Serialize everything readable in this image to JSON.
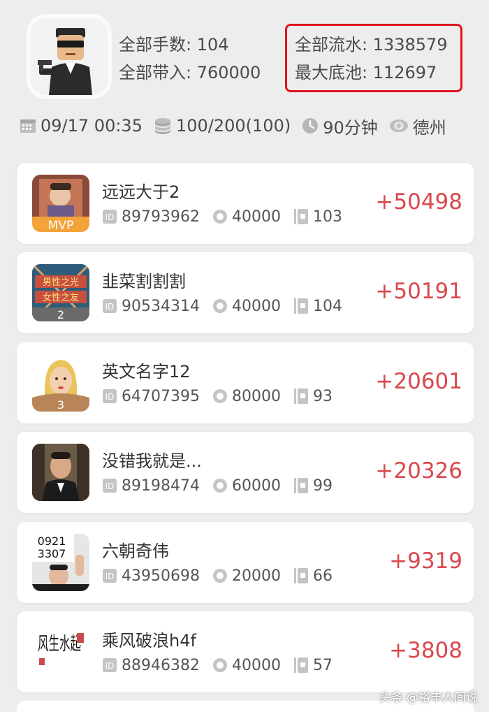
{
  "header": {
    "total_hands": "全部手数: 104",
    "total_buyin": "全部带入: 760000",
    "total_flow": "全部流水: 1338579",
    "max_pot": "最大底池: 112697"
  },
  "meta": {
    "datetime": "09/17 00:35",
    "blinds": "100/200(100)",
    "duration": "90分钟",
    "game": "德州"
  },
  "icons": {
    "calendar": "calendar-icon",
    "coins": "coins-stack-icon",
    "clock": "clock-icon",
    "eye": "eye-icon",
    "id": "id-icon",
    "chip": "chip-icon",
    "cards": "cards-icon"
  },
  "colors": {
    "accent_red": "#e0141e",
    "score_red": "#d9484e"
  },
  "players": [
    {
      "name": "远远大于2",
      "id": "89793962",
      "buyin": "40000",
      "hands": "103",
      "score": "+50498",
      "badge": "MVP"
    },
    {
      "name": "韭菜割割割",
      "id": "90534314",
      "buyin": "40000",
      "hands": "104",
      "score": "+50191",
      "badge": "2"
    },
    {
      "name": "英文名字12",
      "id": "64707395",
      "buyin": "80000",
      "hands": "93",
      "score": "+20601",
      "badge": "3"
    },
    {
      "name": "没错我就是...",
      "id": "89198474",
      "buyin": "60000",
      "hands": "99",
      "score": "+20326",
      "badge": ""
    },
    {
      "name": "六朝奇伟",
      "id": "43950698",
      "buyin": "20000",
      "hands": "66",
      "score": "+9319",
      "badge": ""
    },
    {
      "name": "乘风破浪h4f",
      "id": "88946382",
      "buyin": "40000",
      "hands": "57",
      "score": "+3808",
      "badge": ""
    }
  ],
  "avatar_text": {
    "p2_sign_line1": "男性之光",
    "p2_sign_line2": "女性之友",
    "p5_sign_line1": "0921",
    "p5_sign_line2": "3307",
    "p6_calligraphy": "风生水起"
  },
  "watermark": "头条 @裕丰人间说"
}
